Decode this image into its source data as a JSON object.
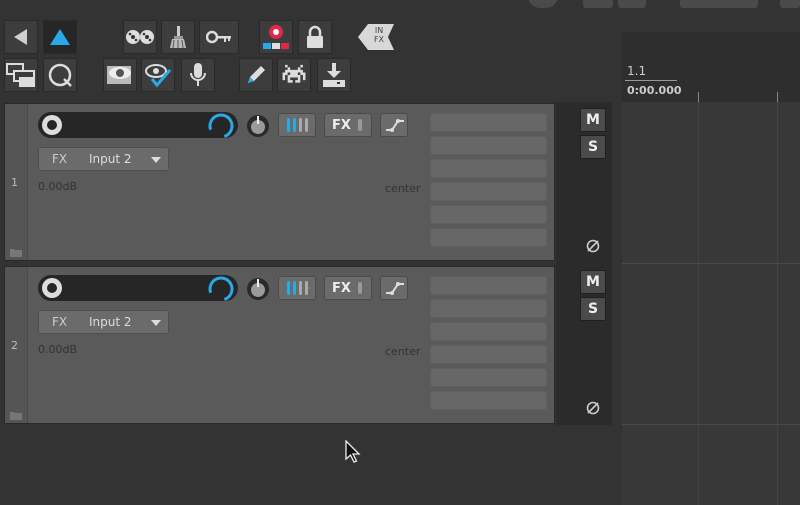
{
  "timeline": {
    "bar_label": "1.1",
    "time_label": "0:00.000"
  },
  "toolbar": {
    "icons": [
      "back-arrow-icon",
      "up-arrow-icon",
      "tape-reels-icon",
      "broom-icon",
      "key-icon",
      "record-arm-icon",
      "lock-icon",
      "in-fx-icon",
      "folder-stack-icon",
      "loop-icon",
      "eye-monitor-icon",
      "eye-check-icon",
      "microphone-icon",
      "pencil-icon",
      "space-invader-icon",
      "download-icon"
    ],
    "in_fx_line1": "IN",
    "in_fx_line2": "FX"
  },
  "tracks": [
    {
      "number": "1",
      "fx_label": "FX",
      "input_label": "Input 2",
      "volume": "0.00dB",
      "pan": "center",
      "fx_button": "FX",
      "mute": "M",
      "solo": "S"
    },
    {
      "number": "2",
      "fx_label": "FX",
      "input_label": "Input 2",
      "volume": "0.00dB",
      "pan": "center",
      "fx_button": "FX",
      "mute": "M",
      "solo": "S"
    }
  ],
  "colors": {
    "accent_blue": "#2aa8e8",
    "record_red": "#e0284a",
    "background": "#333333"
  }
}
